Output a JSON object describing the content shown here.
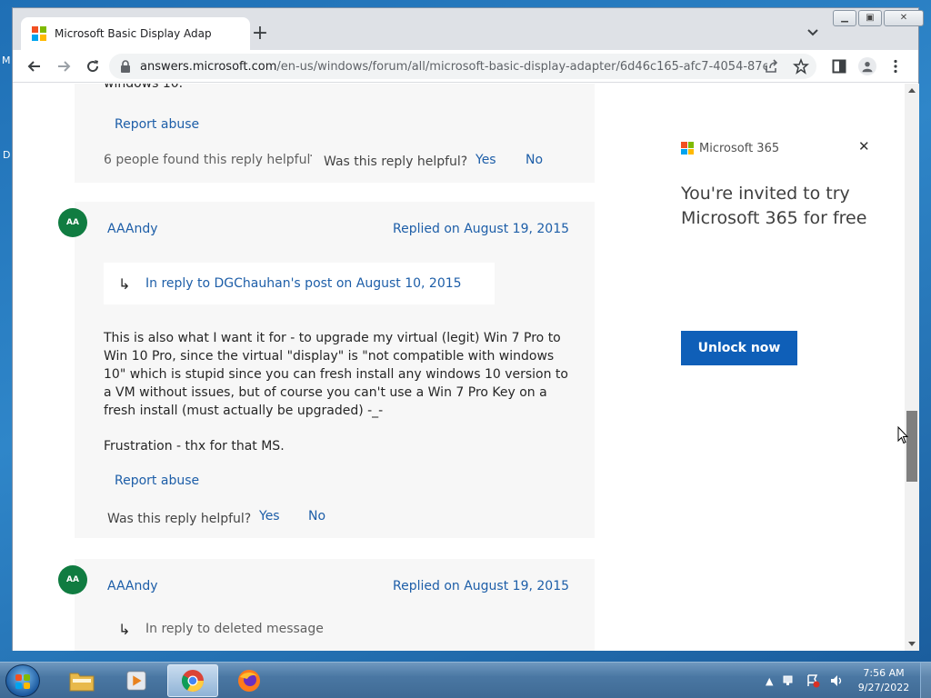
{
  "window": {
    "tab_title": "Microsoft Basic Display Adapter - ",
    "url_host": "answers.microsoft.com",
    "url_path": "/en-us/windows/forum/all/microsoft-basic-display-adapter/6d46c165-afc7-4054-87e..."
  },
  "posts": [
    {
      "partial_text": "windows 10.",
      "report_label": "Report abuse",
      "helpful_count": "6 people found this reply helpful",
      "dot": "·",
      "helpful_prompt": "Was this reply helpful?",
      "yes": "Yes",
      "no": "No"
    },
    {
      "initials": "AA",
      "author": "AAAndy",
      "date": "Replied on August 19, 2015",
      "in_reply_to": "In reply to DGChauhan's post on August 10, 2015",
      "body_1": "This is also what I want it for - to upgrade my virtual (legit) Win 7 Pro to Win 10 Pro, since the virtual \"display\" is \"not compatible with windows 10\" which is stupid since you can fresh install any windows 10 version to a VM without issues, but of course you can't use a Win 7 Pro Key on a fresh install (must actually be upgraded) -_-",
      "body_2": "Frustration - thx for that MS.",
      "report_label": "Report abuse",
      "helpful_prompt": "Was this reply helpful?",
      "yes": "Yes",
      "no": "No"
    },
    {
      "initials": "AA",
      "author": "AAAndy",
      "date": "Replied on August 19, 2015",
      "in_reply_to": "In reply to deleted message"
    }
  ],
  "ad": {
    "brand": "Microsoft 365",
    "title": "You're invited to try Microsoft 365 for free",
    "cta": "Unlock now"
  },
  "taskbar": {
    "time": "7:56 AM",
    "date": "9/27/2022"
  },
  "desktop": {
    "glyph_1": "M",
    "glyph_2": "D"
  },
  "colors": {
    "accent": "#1d5ea8",
    "avatar": "#107c41",
    "cta": "#0f5fb8",
    "ms_red": "#f25022",
    "ms_green": "#7fba00",
    "ms_blue": "#00a4ef",
    "ms_yellow": "#ffb900"
  },
  "icons": [
    "back-icon",
    "forward-icon",
    "reload-icon",
    "lock-icon",
    "share-icon",
    "star-icon",
    "sidebar-icon",
    "profile-icon",
    "menu-icon",
    "close-icon",
    "reply-arrow-icon",
    "chevron-down-icon"
  ]
}
